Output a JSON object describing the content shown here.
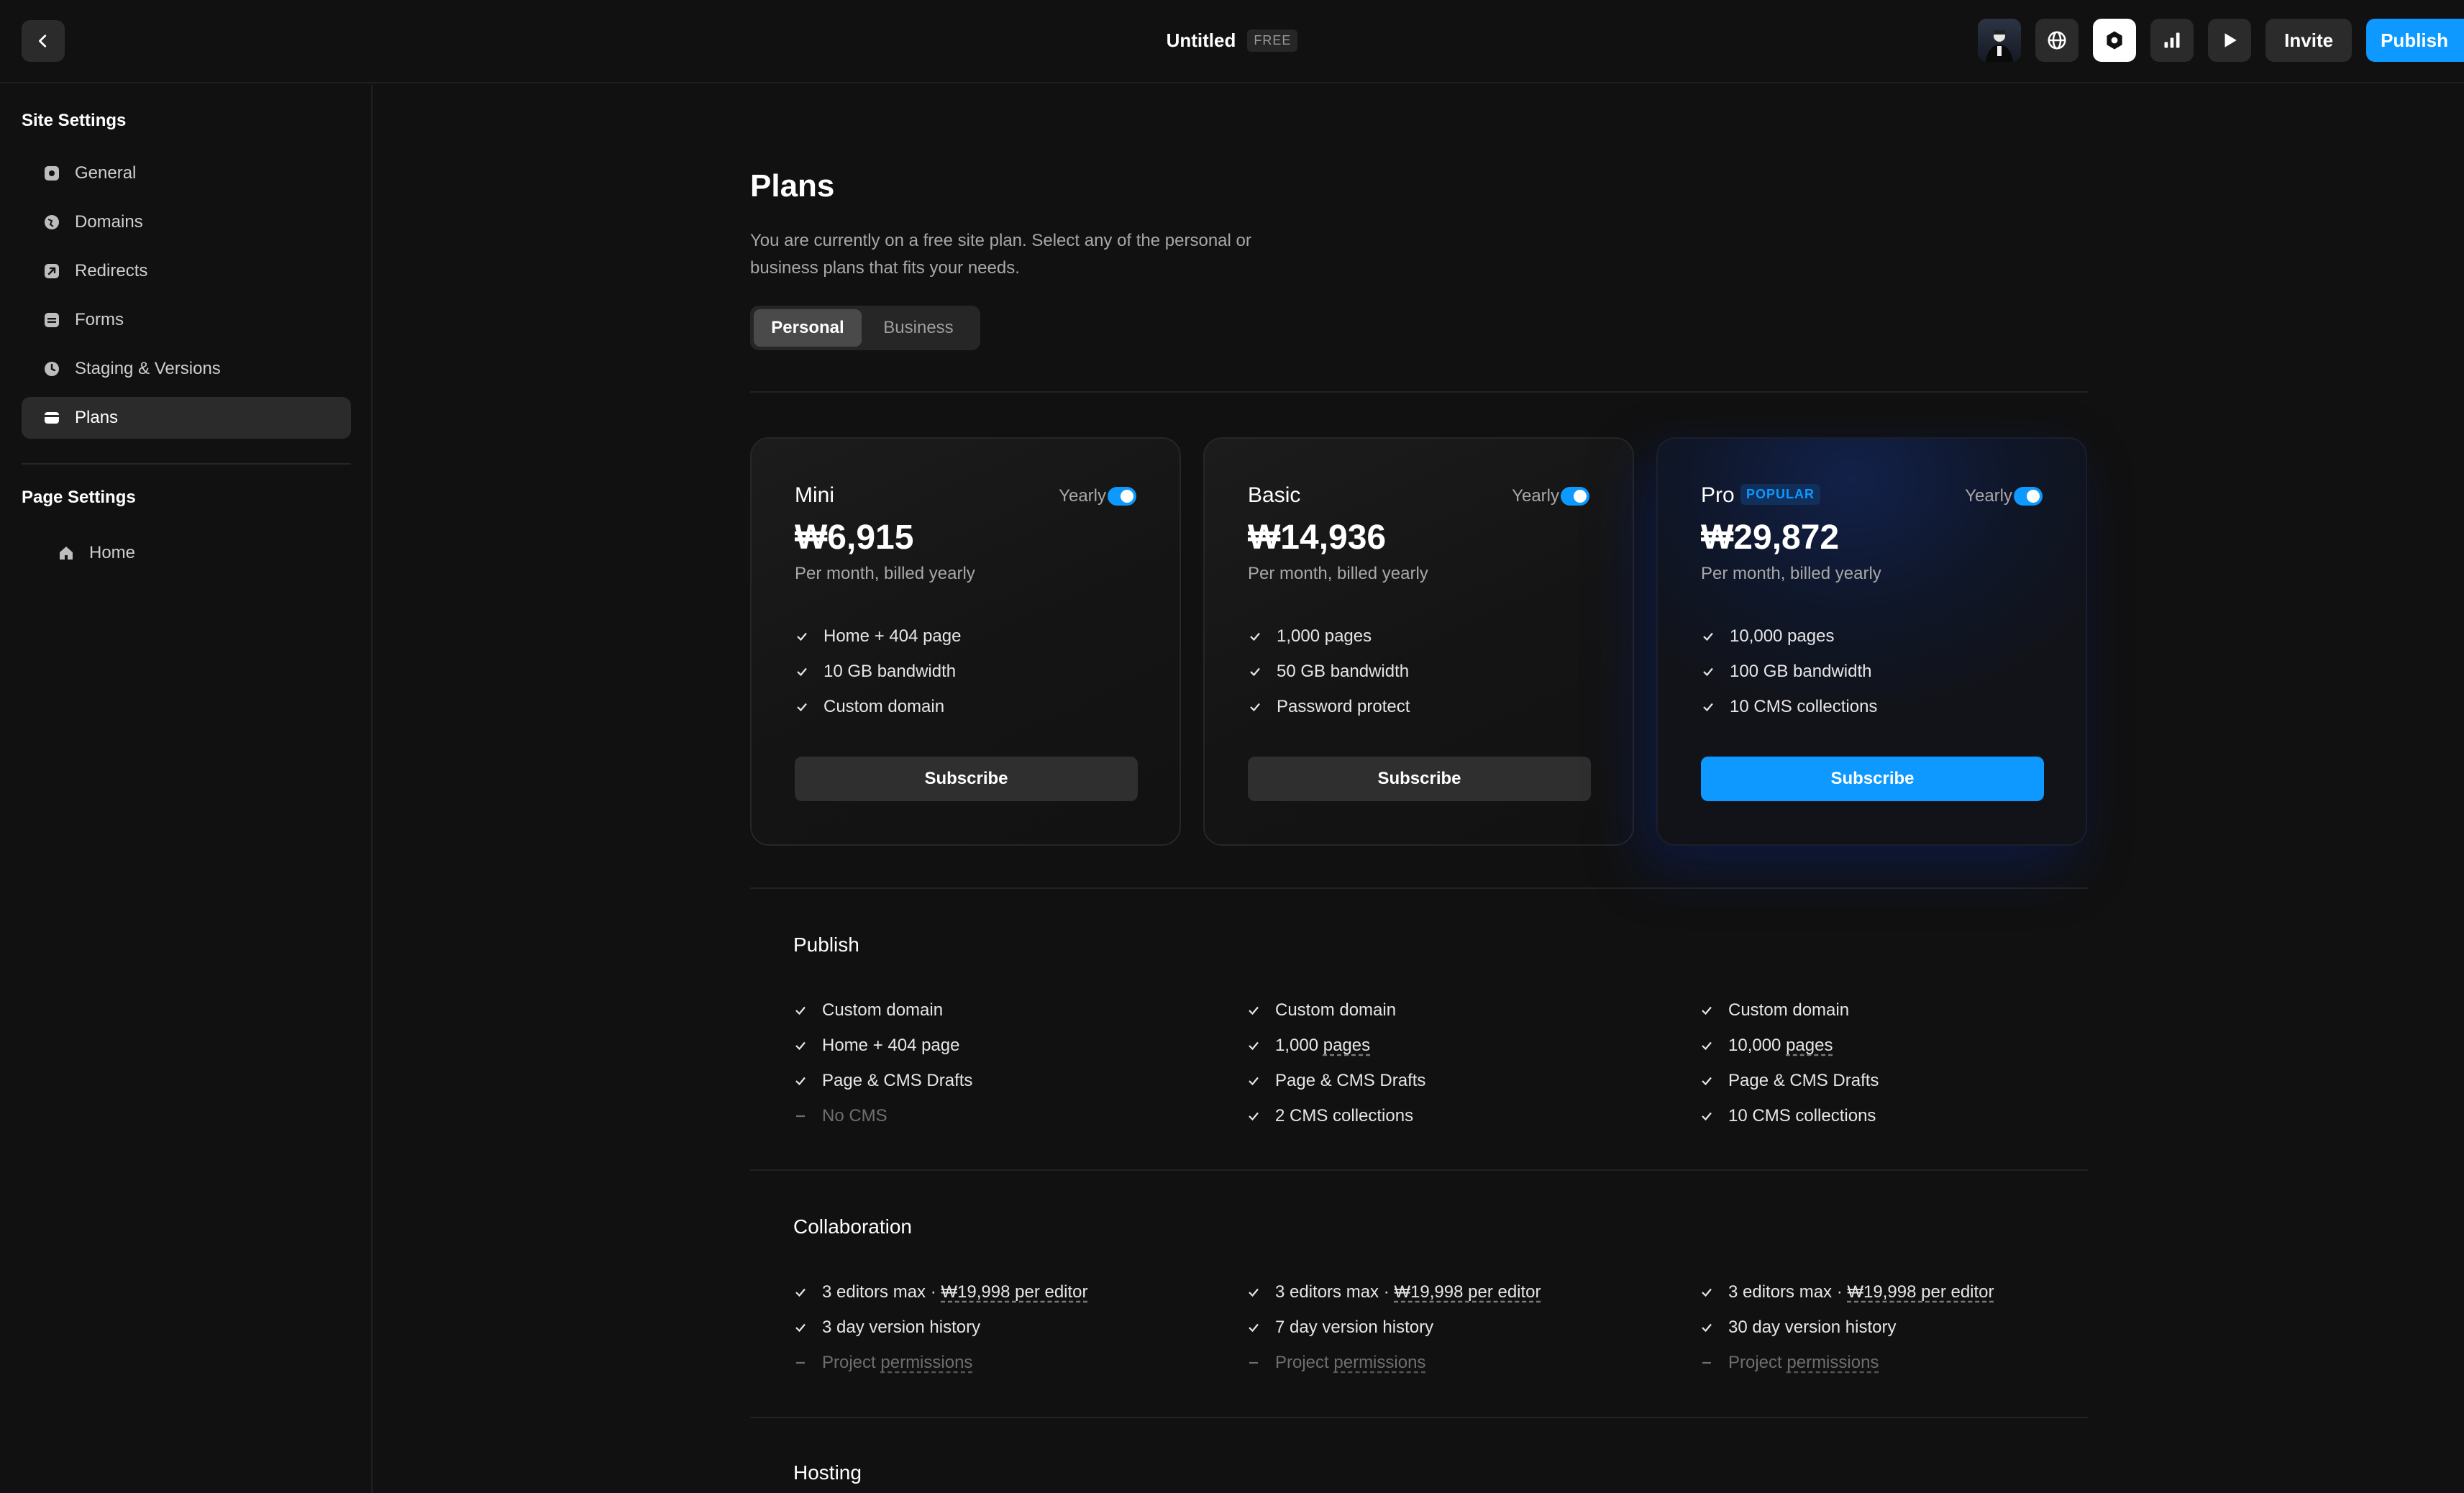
{
  "topbar": {
    "title": "Untitled",
    "plan_badge": "FREE",
    "invite_label": "Invite",
    "publish_label": "Publish"
  },
  "sidebar": {
    "site_settings_title": "Site Settings",
    "site_items": [
      {
        "label": "General",
        "icon": "gear-icon"
      },
      {
        "label": "Domains",
        "icon": "globe-icon"
      },
      {
        "label": "Redirects",
        "icon": "redirect-icon"
      },
      {
        "label": "Forms",
        "icon": "form-icon"
      },
      {
        "label": "Staging & Versions",
        "icon": "clock-icon"
      },
      {
        "label": "Plans",
        "icon": "card-icon",
        "active": true
      }
    ],
    "page_settings_title": "Page Settings",
    "page_items": [
      {
        "label": "Home",
        "icon": "home-icon"
      }
    ]
  },
  "main": {
    "title": "Plans",
    "description": "You are currently on a free site plan. Select any of the personal or business plans that fits your needs.",
    "tabs": [
      {
        "label": "Personal",
        "active": true
      },
      {
        "label": "Business",
        "active": false
      }
    ],
    "plans": [
      {
        "name": "Mini",
        "popular": "",
        "yearly_label": "Yearly",
        "yearly_on": true,
        "price": "₩6,915",
        "billing": "Per month, billed yearly",
        "features": [
          "Home + 404 page",
          "10 GB bandwidth",
          "Custom domain"
        ],
        "cta": "Subscribe"
      },
      {
        "name": "Basic",
        "popular": "",
        "yearly_label": "Yearly",
        "yearly_on": true,
        "price": "₩14,936",
        "billing": "Per month, billed yearly",
        "features": [
          "1,000 pages",
          "50 GB bandwidth",
          "Password protect"
        ],
        "cta": "Subscribe"
      },
      {
        "name": "Pro",
        "popular": "POPULAR",
        "yearly_label": "Yearly",
        "yearly_on": true,
        "price": "₩29,872",
        "billing": "Per month, billed yearly",
        "features": [
          "10,000 pages",
          "100 GB bandwidth",
          "10 CMS collections"
        ],
        "cta": "Subscribe"
      }
    ],
    "sections": [
      {
        "title": "Publish",
        "columns": [
          [
            {
              "pre": "Custom domain",
              "u": "",
              "included": true
            },
            {
              "pre": "Home + 404 page",
              "u": "",
              "included": true
            },
            {
              "pre": "Page & CMS Drafts",
              "u": "",
              "included": true
            },
            {
              "pre": "No CMS",
              "u": "",
              "included": false
            }
          ],
          [
            {
              "pre": "Custom domain",
              "u": "",
              "included": true
            },
            {
              "pre": "1,000 ",
              "u": "pages",
              "included": true
            },
            {
              "pre": "Page & CMS Drafts",
              "u": "",
              "included": true
            },
            {
              "pre": "2 CMS collections",
              "u": "",
              "included": true
            }
          ],
          [
            {
              "pre": "Custom domain",
              "u": "",
              "included": true
            },
            {
              "pre": "10,000 ",
              "u": "pages",
              "included": true
            },
            {
              "pre": "Page & CMS Drafts",
              "u": "",
              "included": true
            },
            {
              "pre": "10 CMS collections",
              "u": "",
              "included": true
            }
          ]
        ]
      },
      {
        "title": "Collaboration",
        "columns": [
          [
            {
              "pre": "3 editors max · ",
              "u": "₩19,998 per editor",
              "included": true
            },
            {
              "pre": "3 day version history",
              "u": "",
              "included": true
            },
            {
              "pre": "Project ",
              "u": "permissions",
              "included": false
            }
          ],
          [
            {
              "pre": "3 editors max · ",
              "u": "₩19,998 per editor",
              "included": true
            },
            {
              "pre": "7 day version history",
              "u": "",
              "included": true
            },
            {
              "pre": "Project ",
              "u": "permissions",
              "included": false
            }
          ],
          [
            {
              "pre": "3 editors max · ",
              "u": "₩19,998 per editor",
              "included": true
            },
            {
              "pre": "30 day version history",
              "u": "",
              "included": true
            },
            {
              "pre": "Project ",
              "u": "permissions",
              "included": false
            }
          ]
        ]
      },
      {
        "title": "Hosting",
        "columns": []
      }
    ]
  },
  "colors": {
    "accent": "#0d99ff",
    "background": "#111111",
    "surface": "#2b2b2b"
  }
}
